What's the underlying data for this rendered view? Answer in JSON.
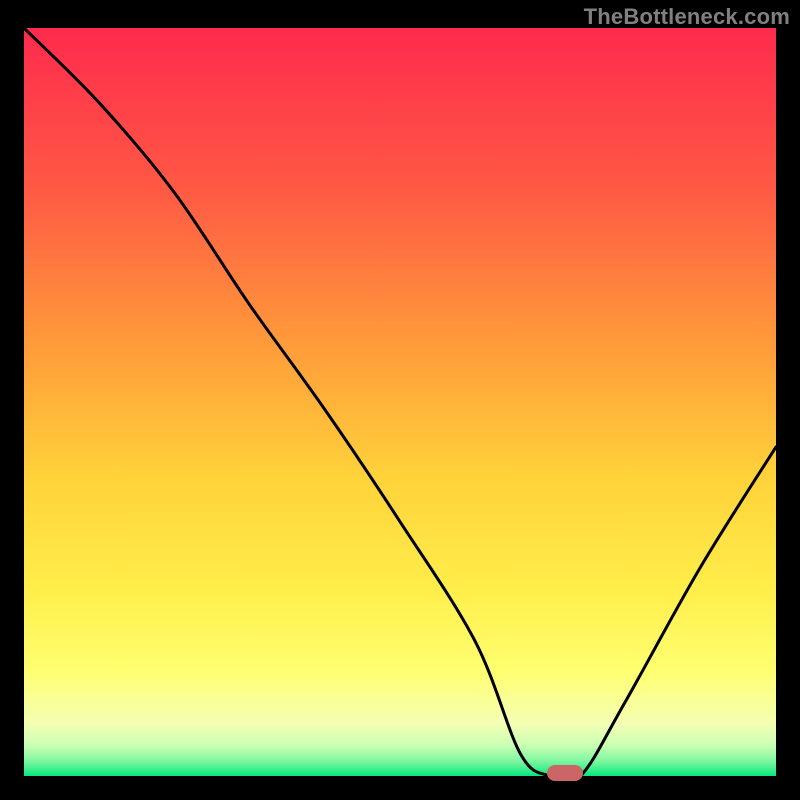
{
  "watermark": "TheBottleneck.com",
  "colors": {
    "bg": "#000000",
    "grad_top": "#ff2a4d",
    "grad_mid1": "#ff8a3a",
    "grad_mid2": "#ffd93a",
    "grad_mid3": "#ffff66",
    "grad_mid4": "#f5ffb0",
    "grad_bottom": "#08e67d",
    "curve": "#000000",
    "marker": "#cc6666",
    "watermark": "#808080"
  },
  "chart_data": {
    "type": "line",
    "title": "",
    "xlabel": "",
    "ylabel": "",
    "xlim": [
      0,
      100
    ],
    "ylim": [
      0,
      100
    ],
    "x": [
      0,
      10,
      20,
      30,
      40,
      50,
      60,
      66,
      70,
      74,
      80,
      90,
      100
    ],
    "y": [
      100,
      90,
      78,
      63,
      49,
      34,
      18,
      3,
      0,
      0,
      10,
      28,
      44
    ],
    "marker_x": 72,
    "marker_y": 0
  }
}
